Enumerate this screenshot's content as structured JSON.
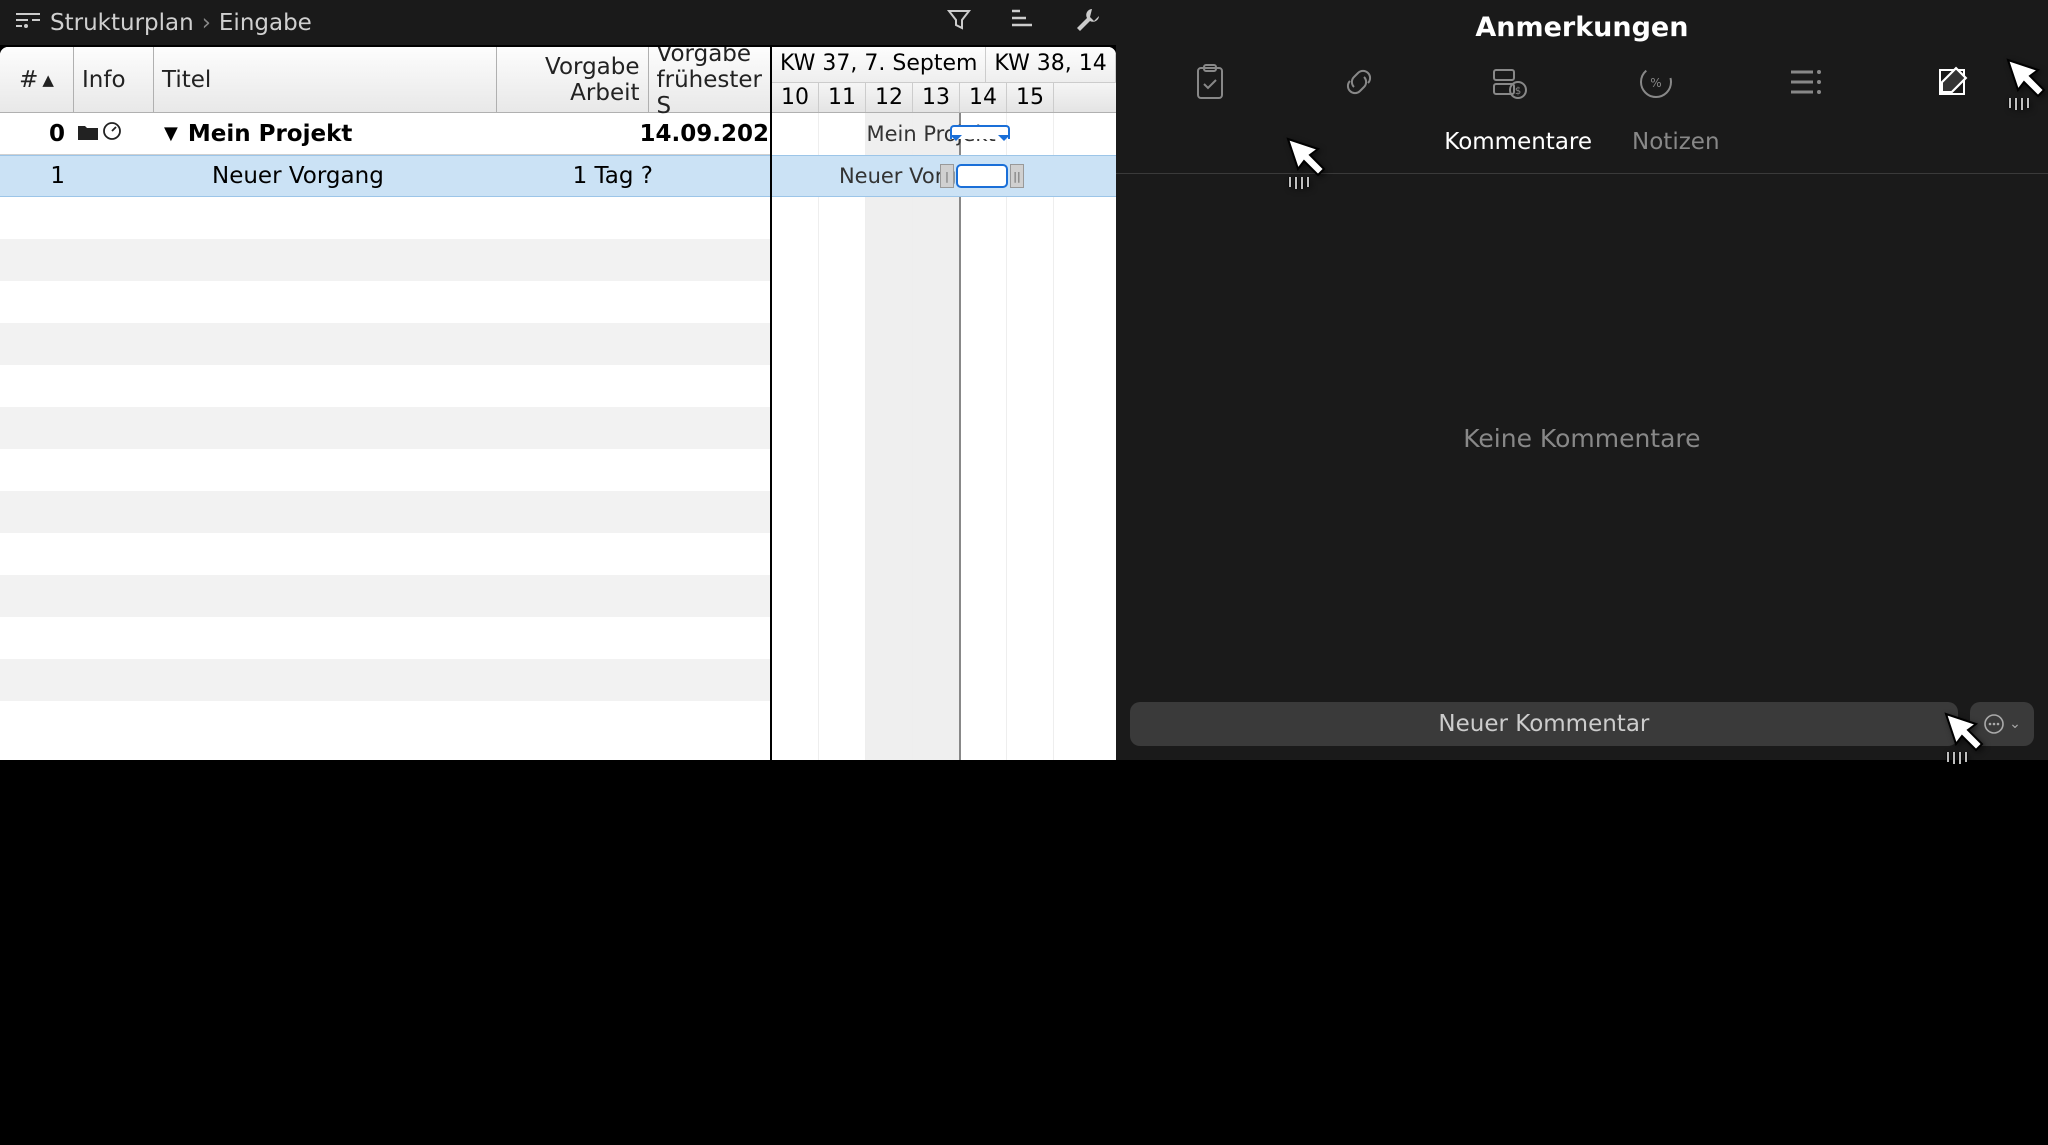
{
  "topbar": {
    "crumb1": "Strukturplan",
    "crumb2": "Eingabe"
  },
  "grid": {
    "headers": {
      "num": "#",
      "info": "Info",
      "title": "Titel",
      "work_l1": "Vorgabe",
      "work_l2": "Arbeit",
      "start_l1": "Vorgabe",
      "start_l2": "frühester S"
    },
    "rows": [
      {
        "num": "0",
        "title": "Mein Projekt",
        "work": "",
        "start": "14.09.202"
      },
      {
        "num": "1",
        "title": "Neuer Vorgang",
        "work": "1 Tag ?",
        "start": ""
      }
    ]
  },
  "gantt": {
    "weeks": [
      "KW 37, 7. Septem",
      "KW 38, 14"
    ],
    "days": [
      "10",
      "11",
      "12",
      "13",
      "14",
      "15"
    ],
    "bars": [
      {
        "label": "Mein Projekt"
      },
      {
        "label": "Neuer Vorgang"
      }
    ]
  },
  "panel": {
    "title": "Anmerkungen",
    "tabs": {
      "comments": "Kommentare",
      "notes": "Notizen"
    },
    "empty": "Keine Kommentare",
    "new_btn": "Neuer Kommentar"
  }
}
